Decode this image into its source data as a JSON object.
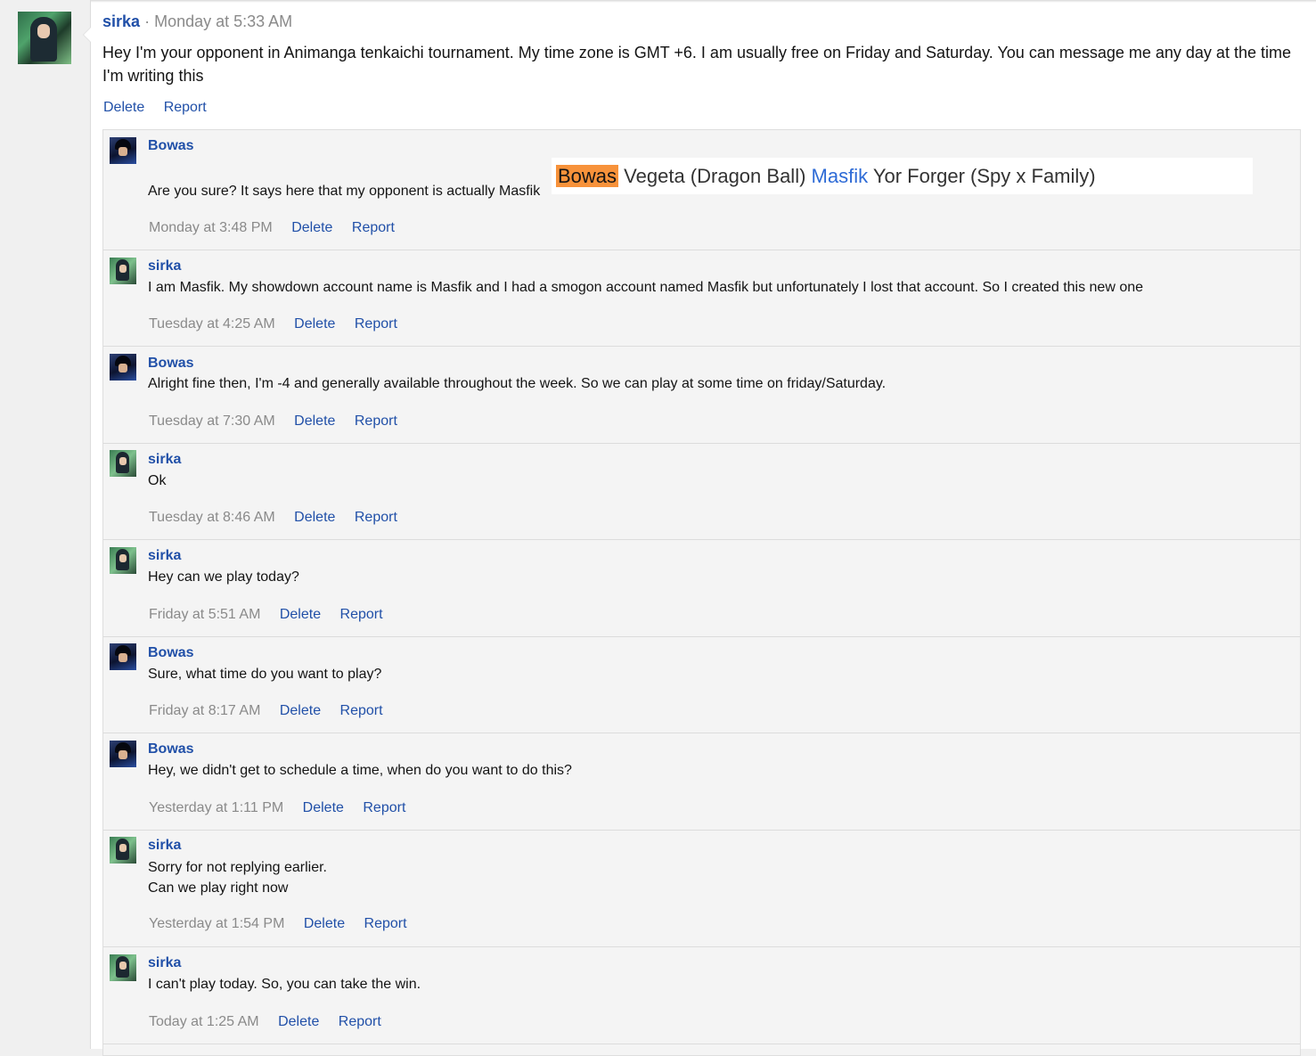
{
  "post": {
    "author": "sirka",
    "separator": "·",
    "time": "Monday at 5:33 AM",
    "text": "Hey I'm your opponent in Animanga tenkaichi tournament. My time zone is GMT +6. I am usually free on Friday and Saturday. You can message me any day at the time I'm writing this",
    "delete_label": "Delete",
    "report_label": "Report"
  },
  "embed": {
    "name1": "Bowas",
    "char1": "Vegeta (Dragon Ball)",
    "name2": "Masfik",
    "char2": "Yor Forger (Spy x Family)"
  },
  "comments": [
    {
      "author": "Bowas",
      "text": "Are you sure? It says here that my opponent is actually Masfik",
      "time": "Monday at 3:48 PM",
      "delete": "Delete",
      "report": "Report"
    },
    {
      "author": "sirka",
      "text": "I am Masfik. My showdown account name is Masfik and I had a smogon account named Masfik but unfortunately I lost that account. So I created this new one",
      "time": "Tuesday at 4:25 AM",
      "delete": "Delete",
      "report": "Report"
    },
    {
      "author": "Bowas",
      "text": "Alright fine then, I'm -4 and generally available throughout the week. So we can play at some time on friday/Saturday.",
      "time": "Tuesday at 7:30 AM",
      "delete": "Delete",
      "report": "Report"
    },
    {
      "author": "sirka",
      "text": "Ok",
      "time": "Tuesday at 8:46 AM",
      "delete": "Delete",
      "report": "Report"
    },
    {
      "author": "sirka",
      "text": "Hey can we play today?",
      "time": "Friday at 5:51 AM",
      "delete": "Delete",
      "report": "Report"
    },
    {
      "author": "Bowas",
      "text": "Sure, what time do you want to play?",
      "time": "Friday at 8:17 AM",
      "delete": "Delete",
      "report": "Report"
    },
    {
      "author": "Bowas",
      "text": "Hey, we didn't get to schedule a time, when do you want to do this?",
      "time": "Yesterday at 1:11 PM",
      "delete": "Delete",
      "report": "Report"
    },
    {
      "author": "sirka",
      "text": "Sorry for not replying earlier.",
      "text2": "Can we play right now",
      "time": "Yesterday at 1:54 PM",
      "delete": "Delete",
      "report": "Report"
    },
    {
      "author": "sirka",
      "text": "I can't play today. So, you can take the win.",
      "time": "Today at 1:25 AM",
      "delete": "Delete",
      "report": "Report"
    }
  ]
}
